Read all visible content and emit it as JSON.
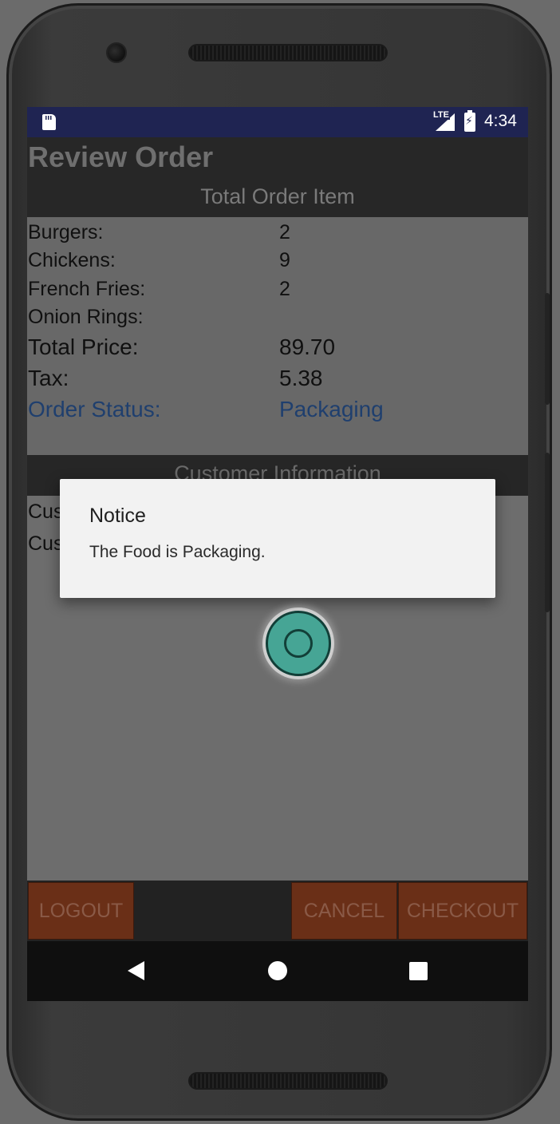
{
  "status_bar": {
    "time": "4:34",
    "network": "LTE"
  },
  "page": {
    "title": "Review Order"
  },
  "order": {
    "header": "Total Order Item",
    "items": [
      {
        "label": "Burgers:",
        "value": "2"
      },
      {
        "label": "Chickens:",
        "value": "9"
      },
      {
        "label": "French Fries:",
        "value": "2"
      },
      {
        "label": "Onion Rings:",
        "value": ""
      }
    ],
    "total_price": {
      "label": "Total Price:",
      "value": "89.70"
    },
    "tax": {
      "label": "Tax:",
      "value": "5.38"
    },
    "status": {
      "label": "Order Status:",
      "value": "Packaging"
    }
  },
  "customer": {
    "header": "Customer Information",
    "rows": [
      {
        "label_partial": "Cus"
      },
      {
        "label_partial": "Cus"
      }
    ]
  },
  "buttons": {
    "logout": "LOGOUT",
    "cancel": "CANCEL",
    "checkout": "CHECKOUT"
  },
  "dialog": {
    "title": "Notice",
    "message": "The Food is Packaging."
  },
  "icons": {
    "sd": "sd-card-icon",
    "signal": "lte-signal-icon",
    "battery": "battery-charging-icon"
  },
  "colors": {
    "status_bar": "#1f2452",
    "button_bg": "#6a2f17",
    "status_text": "#1f3f6e"
  }
}
